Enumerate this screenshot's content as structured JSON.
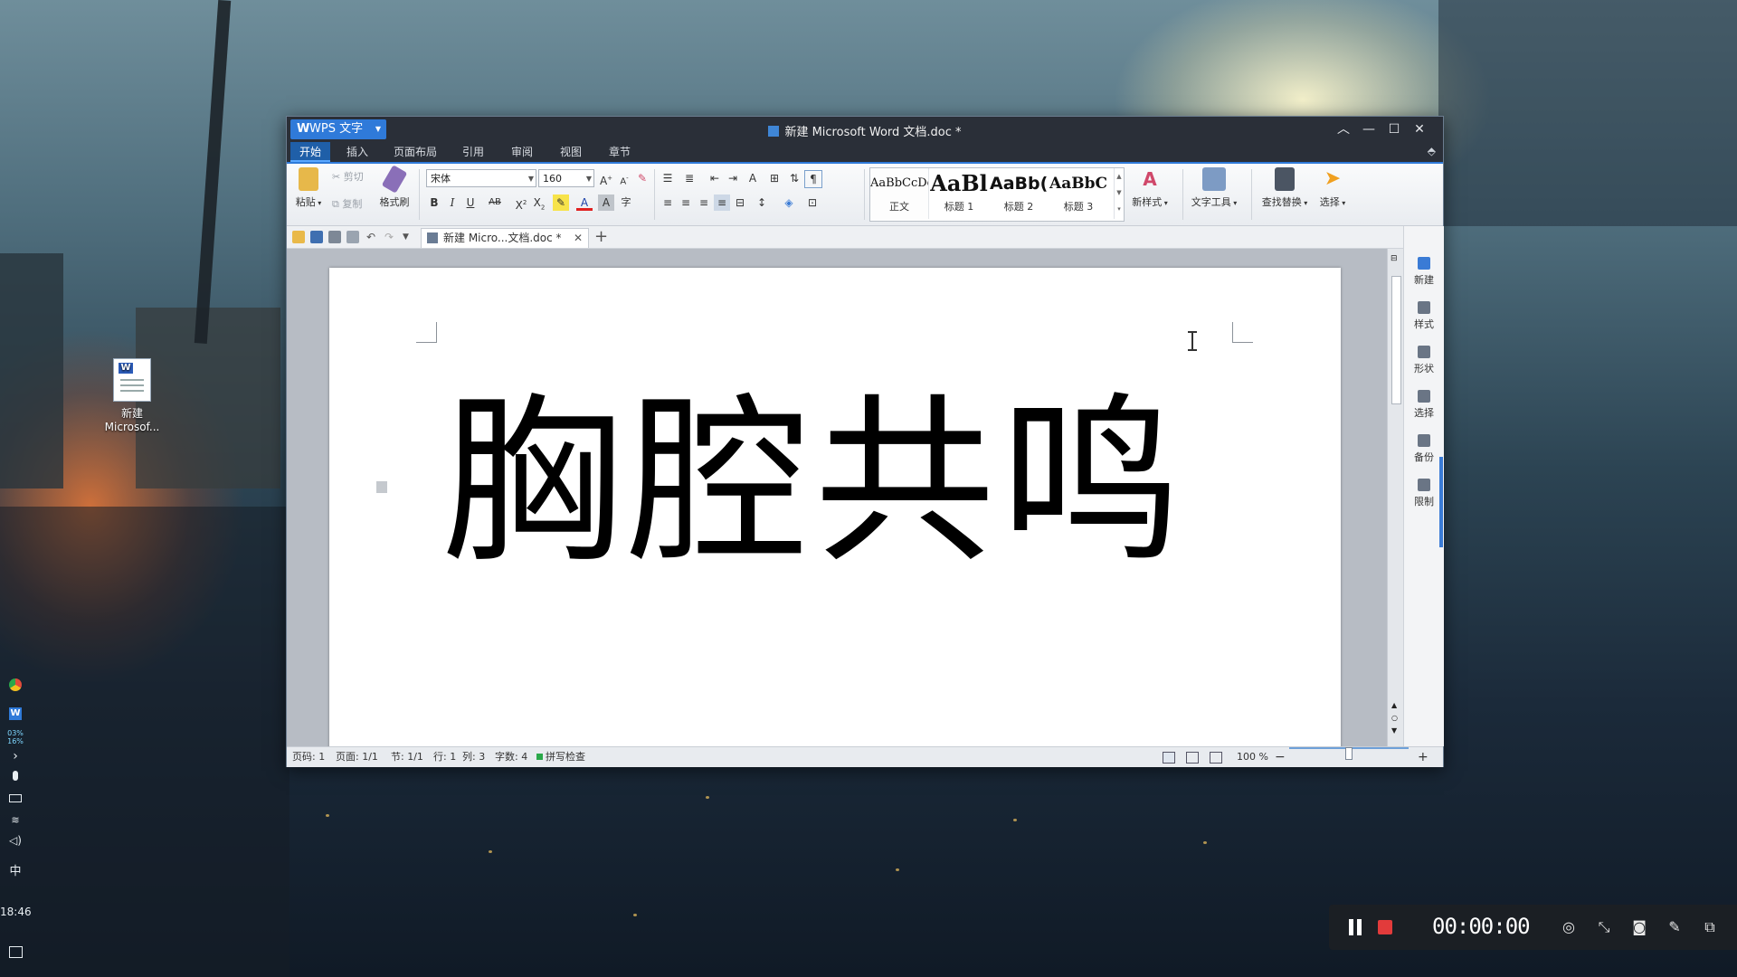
{
  "desktop": {
    "icon_label_line1": "新建",
    "icon_label_line2": "Microsof..."
  },
  "taskbar": {
    "cpu_mem": "03%\n16%",
    "ime": "中",
    "clock": "18:46"
  },
  "window": {
    "app_button": "WPS 文字",
    "title": "新建 Microsoft Word 文档.doc *"
  },
  "menu": {
    "tabs": [
      "开始",
      "插入",
      "页面布局",
      "引用",
      "审阅",
      "视图",
      "章节"
    ]
  },
  "ribbon": {
    "paste": "粘贴",
    "cut": "剪切",
    "copy": "复制",
    "format_painter": "格式刷",
    "font_name": "宋体",
    "font_size": "160",
    "styles": [
      {
        "preview": "AaBbCcDd",
        "name": "正文"
      },
      {
        "preview": "AaBl",
        "name": "标题 1"
      },
      {
        "preview": "AaBb(",
        "name": "标题 2"
      },
      {
        "preview": "AaBbC",
        "name": "标题 3"
      }
    ],
    "new_style": "新样式",
    "text_tools": "文字工具",
    "find_replace": "查找替换",
    "select": "选择"
  },
  "doc_tab": {
    "label": "新建 Micro...文档.doc *"
  },
  "document": {
    "text": "胸腔共鸣"
  },
  "side_panel": [
    "新建",
    "样式",
    "形状",
    "选择",
    "备份",
    "限制"
  ],
  "status": {
    "page_no": "页码: 1",
    "pages": "页面: 1/1",
    "section": "节: 1/1",
    "row": "行: 1",
    "col": "列: 3",
    "word_count": "字数: 4",
    "spell_check": "拼写检查",
    "zoom": "100 %",
    "zoom_fraction": 0.5
  },
  "recorder": {
    "time": "00:00:00"
  },
  "colors": {
    "accent": "#2f7ad9",
    "titlebar": "#2a2f38",
    "record": "#e23b3b"
  }
}
